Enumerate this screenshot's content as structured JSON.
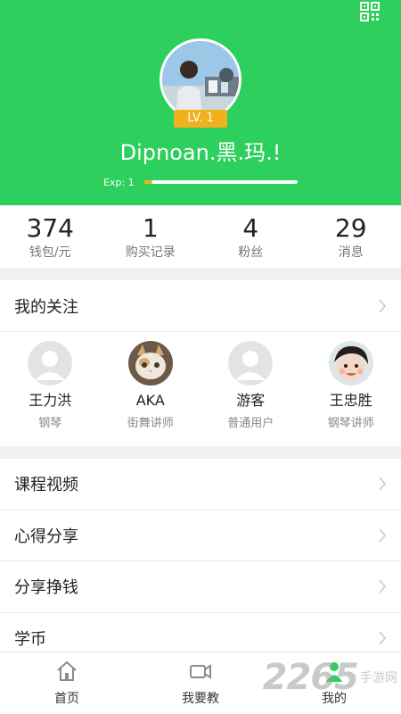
{
  "header": {
    "username": "Dipnoan.黑.玛.!",
    "level": "LV. 1",
    "exp_label": "Exp:  1",
    "exp_progress": 0.05,
    "background_color": "#2dcf5d",
    "accent_color": "#f2b01e"
  },
  "stats": [
    {
      "value": "374",
      "label": "钱包/元"
    },
    {
      "value": "1",
      "label": "购买记录"
    },
    {
      "value": "4",
      "label": "粉丝"
    },
    {
      "value": "29",
      "label": "消息"
    }
  ],
  "follow": {
    "title": "我的关注",
    "people": [
      {
        "name": "王力洪",
        "role": "钢琴",
        "avatar": "default-avatar"
      },
      {
        "name": "AKA",
        "role": "街舞讲师",
        "avatar": "cat-photo"
      },
      {
        "name": "游客",
        "role": "普通用户",
        "avatar": "default-avatar"
      },
      {
        "name": "王忠胜",
        "role": "钢琴讲师",
        "avatar": "child-photo"
      }
    ]
  },
  "menu": [
    {
      "label": "课程视频"
    },
    {
      "label": "心得分享"
    },
    {
      "label": "分享挣钱"
    },
    {
      "label": "学币"
    }
  ],
  "tabbar": [
    {
      "label": "首页",
      "icon": "home-icon"
    },
    {
      "label": "我要教",
      "icon": "video-camera-icon"
    },
    {
      "label": "我的",
      "icon": "person-icon"
    }
  ],
  "watermark": {
    "number": "2265",
    "text": "手游网"
  }
}
